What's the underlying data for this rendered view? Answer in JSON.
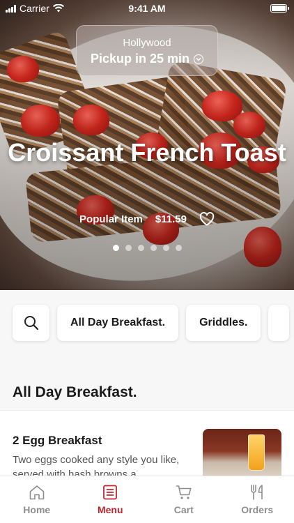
{
  "status_bar": {
    "carrier": "Carrier",
    "time": "9:41 AM"
  },
  "location": {
    "name": "Hollywood",
    "pickup": "Pickup in 25 min"
  },
  "hero": {
    "title": "Croissant French Toast",
    "tag": "Popular Item",
    "price": "$11.59",
    "slide_count": 6,
    "active_slide": 1
  },
  "categories": {
    "items": [
      "All Day Breakfast.",
      "Griddles."
    ]
  },
  "section": {
    "title": "All Day Breakfast."
  },
  "menu_item": {
    "name": "2 Egg Breakfast",
    "description": "Two eggs cooked any style you like, served with hash browns a..."
  },
  "tabs": [
    {
      "label": "Home",
      "icon": "home-icon",
      "active": false
    },
    {
      "label": "Menu",
      "icon": "menu-icon",
      "active": true
    },
    {
      "label": "Cart",
      "icon": "cart-icon",
      "active": false
    },
    {
      "label": "Orders",
      "icon": "fork-knife-icon",
      "active": false
    }
  ],
  "colors": {
    "accent": "#c0272d",
    "tab_inactive": "#8e8e8e"
  }
}
